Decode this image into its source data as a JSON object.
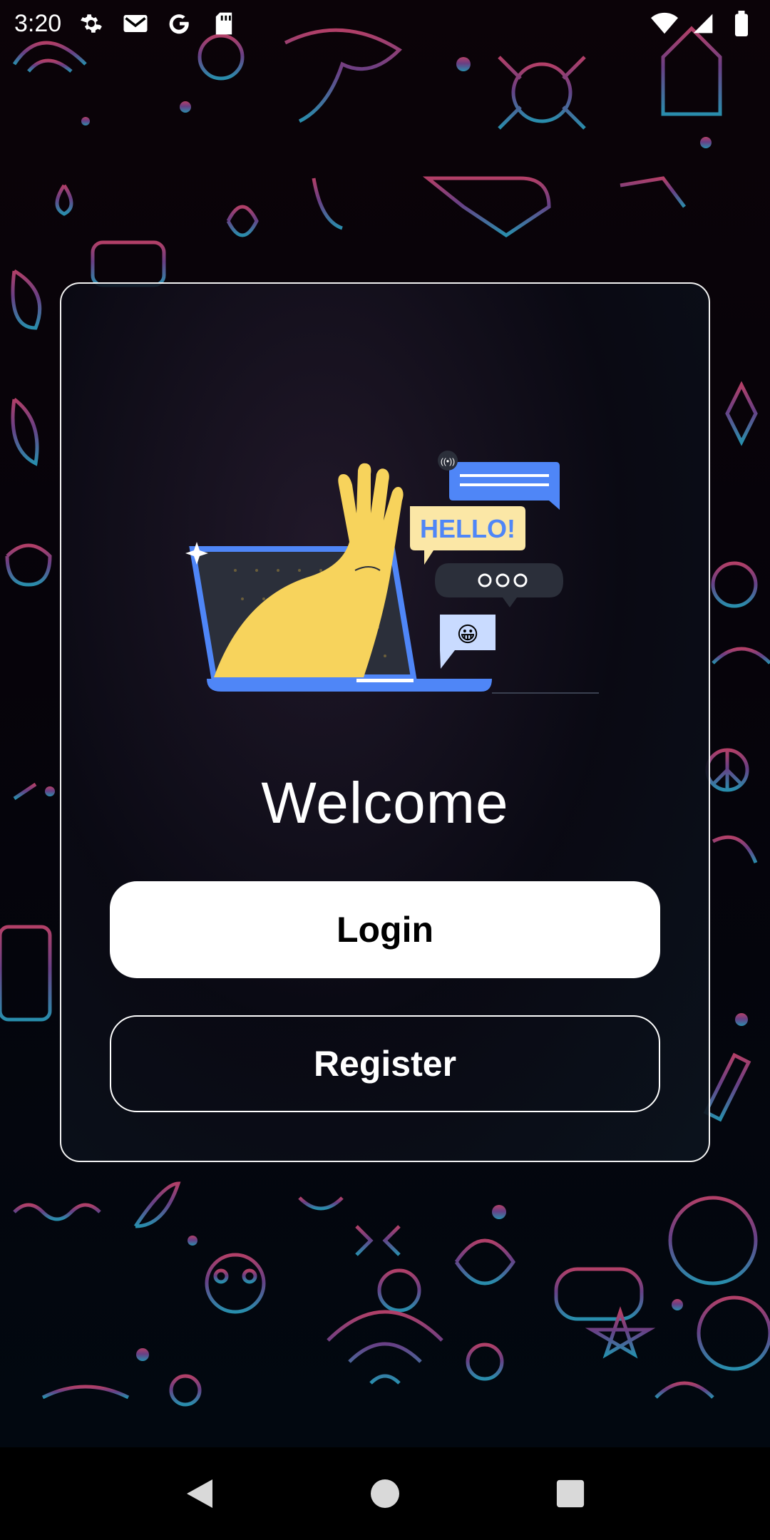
{
  "status_bar": {
    "time": "3:20",
    "icons": [
      "settings-icon",
      "gmail-icon",
      "google-icon",
      "sd-card-icon",
      "wifi-icon",
      "signal-icon",
      "battery-icon"
    ]
  },
  "illustration": {
    "bubble_hello": "HELLO!",
    "emoji": "😀"
  },
  "welcome": {
    "title": "Welcome",
    "login_label": "Login",
    "register_label": "Register"
  },
  "colors": {
    "accent_blue": "#4f86f7",
    "hand_yellow": "#f7d35c",
    "card_border": "#f2f2f2",
    "button_bg": "#ffffff"
  },
  "nav_bar": {
    "buttons": [
      "back-icon",
      "home-icon",
      "recents-icon"
    ]
  }
}
